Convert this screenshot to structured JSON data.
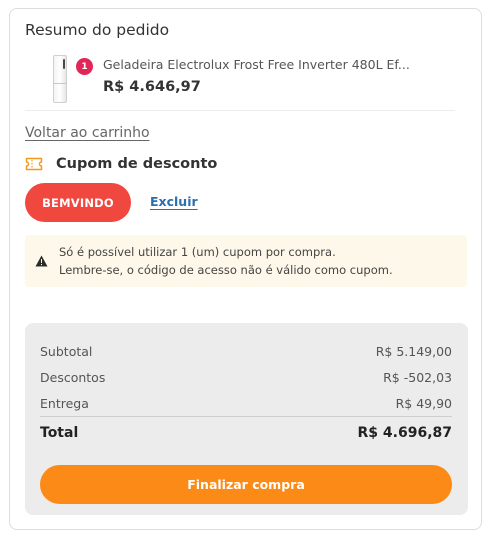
{
  "order_summary": {
    "title": "Resumo do pedido",
    "item": {
      "quantity": "1",
      "name": "Geladeira Electrolux Frost Free Inverter 480L Ef...",
      "price": "R$ 4.646,97",
      "image_icon": "refrigerator-image"
    },
    "back_link": "Voltar ao carrinho"
  },
  "coupon": {
    "title": "Cupom de desconto",
    "icon": "ticket-icon",
    "code": "BEMVINDO",
    "remove_label": "Excluir",
    "notice_icon": "warning-icon",
    "notice_line1": "Só é possível utilizar 1 (um) cupom por compra.",
    "notice_line2": "Lembre-se, o código de acesso não é válido como cupom."
  },
  "totals": {
    "subtotal_label": "Subtotal",
    "subtotal_value": "R$ 5.149,00",
    "discounts_label": "Descontos",
    "discounts_value": "R$ -502,03",
    "shipping_label": "Entrega",
    "shipping_value": "R$ 49,90",
    "total_label": "Total",
    "total_value": "R$ 4.696,87"
  },
  "checkout_label": "Finalizar compra",
  "colors": {
    "coupon_pill": "#f0473f",
    "checkout_button": "#fb8a16",
    "badge": "#e2265a",
    "link": "#2a6fb0",
    "ticket_icon": "#f39a1e",
    "notice_bg": "#fdf8e9"
  }
}
